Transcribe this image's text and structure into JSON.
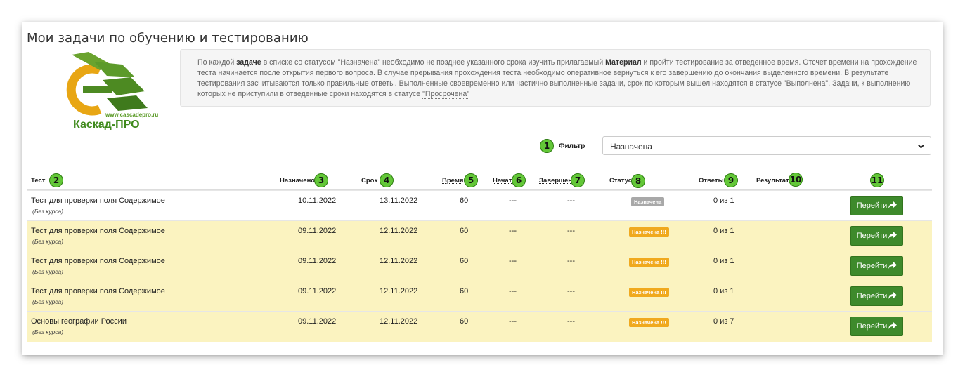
{
  "page_title": "Мои задачи по обучению и тестированию",
  "logo": {
    "url_text": "www.cascadepro.ru",
    "brand": "Каскад-ПРО"
  },
  "info": {
    "p1": "По каждой ",
    "b1": "задаче",
    "p2": " в списке со статусом ",
    "a1": "\"Назначена\"",
    "p3": " необходимо не позднее указанного срока изучить прилагаемый ",
    "b2": "Материал",
    "p4": " и пройти тестирование за отведенное время. Отсчет времени на прохождение теста начинается после открытия первого вопроса. В случае прерывания прохождения теста необходимо оперативное вернуться к его завершению до окончания выделенного времени. В результате тестирования засчитываются только правильные ответы. Выполненные своевременно или частично выполненные задачи, срок по которым вышел находятся в статусе ",
    "a2": "\"Выполнена\"",
    "p5": ". Задачи, к выполнению которых не приступили в отведенные сроки находятся в статусе ",
    "a3": "\"Просрочена\""
  },
  "filter": {
    "label": "Фильтр",
    "value": "Назначена"
  },
  "columns": {
    "test": "Тест",
    "assigned": "Назначено",
    "deadline": "Срок",
    "time": "Время",
    "started": "Начат",
    "finished": "Завершен",
    "status": "Статус",
    "answers": "Ответы",
    "result": "Результат"
  },
  "markers": [
    "1",
    "2",
    "3",
    "4",
    "5",
    "6",
    "7",
    "8",
    "9",
    "10",
    "11"
  ],
  "rows": [
    {
      "test": "Тест для проверки поля Содержимое",
      "course": "(Без курса)",
      "assigned": "10.11.2022",
      "deadline": "13.11.2022",
      "time": "60",
      "started": "---",
      "finished": "---",
      "status": "Назначена",
      "answers": "0 из 1",
      "button": "Перейти"
    },
    {
      "test": "Тест для проверки поля Содержимое",
      "course": "(Без курса)",
      "assigned": "09.11.2022",
      "deadline": "12.11.2022",
      "time": "60",
      "started": "---",
      "finished": "---",
      "status": "Назначена !!!",
      "answers": "0 из 1",
      "button": "Перейти"
    },
    {
      "test": "Тест для проверки поля Содержимое",
      "course": "(Без курса)",
      "assigned": "09.11.2022",
      "deadline": "12.11.2022",
      "time": "60",
      "started": "---",
      "finished": "---",
      "status": "Назначена !!!",
      "answers": "0 из 1",
      "button": "Перейти"
    },
    {
      "test": "Тест для проверки поля Содержимое",
      "course": "(Без курса)",
      "assigned": "09.11.2022",
      "deadline": "12.11.2022",
      "time": "60",
      "started": "---",
      "finished": "---",
      "status": "Назначена !!!",
      "answers": "0 из 1",
      "button": "Перейти"
    },
    {
      "test": "Основы географии России",
      "course": "(Без курса)",
      "assigned": "09.11.2022",
      "deadline": "12.11.2022",
      "time": "60",
      "started": "---",
      "finished": "---",
      "status": "Назначена !!!",
      "answers": "0 из 7",
      "button": "Перейти"
    }
  ],
  "colors": {
    "accent_green": "#3e8a2c",
    "marker_green": "#63c738",
    "row_highlight": "#fbf3c0",
    "status_orange": "#f0a91e",
    "status_grey": "#a8a8a8"
  }
}
